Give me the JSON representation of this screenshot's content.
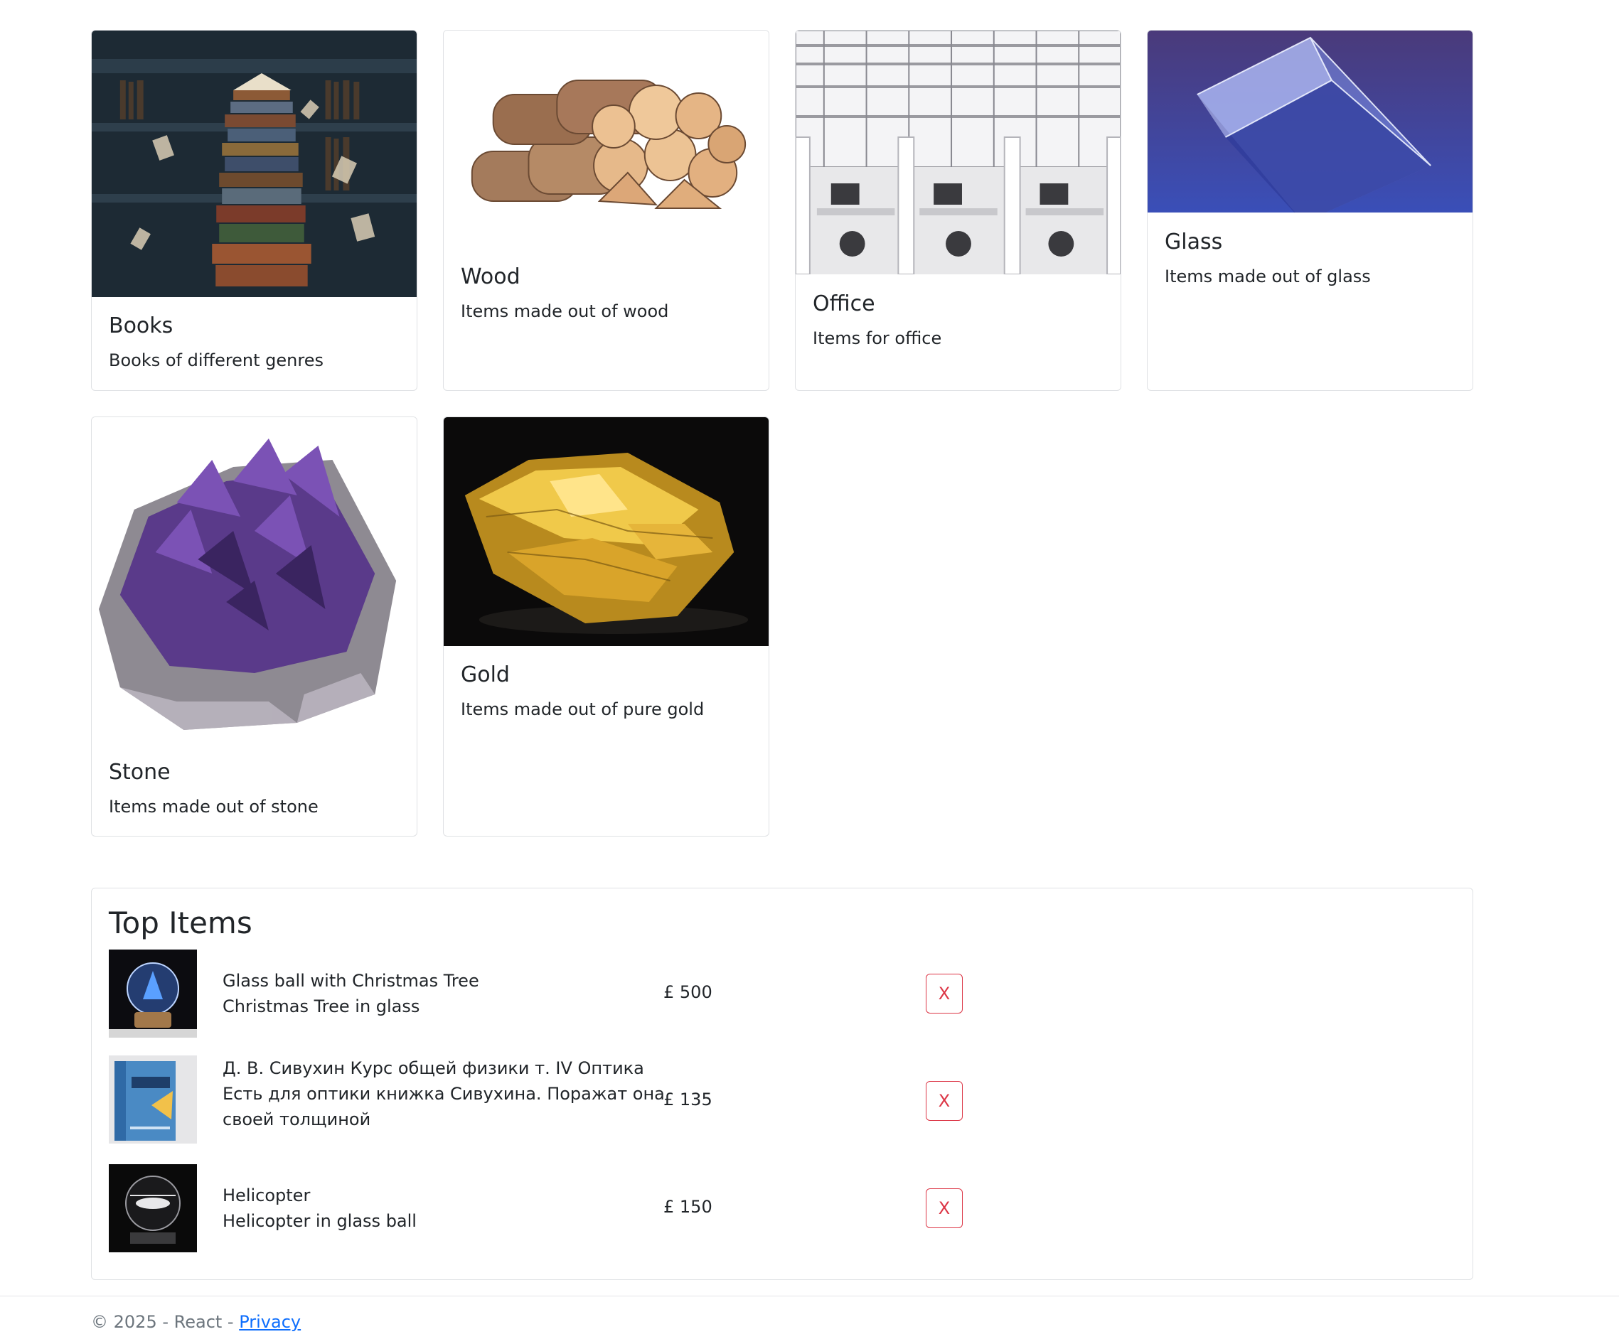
{
  "categories": [
    {
      "title": "Books",
      "description": "Books of different genres",
      "image_icon": "books-image"
    },
    {
      "title": "Wood",
      "description": "Items made out of wood",
      "image_icon": "wood-image"
    },
    {
      "title": "Office",
      "description": "Items for office",
      "image_icon": "office-image"
    },
    {
      "title": "Glass",
      "description": "Items made out of glass",
      "image_icon": "glass-image"
    },
    {
      "title": "Stone",
      "description": "Items made out of stone",
      "image_icon": "stone-image"
    },
    {
      "title": "Gold",
      "description": "Items made out of pure gold",
      "image_icon": "gold-image"
    }
  ],
  "top_items": {
    "title": "Top Items",
    "items": [
      {
        "name": "Glass ball with Christmas Tree",
        "description": "Christmas Tree in glass",
        "price": "£ 500",
        "remove_label": "X"
      },
      {
        "name": "Д. В. Сивухин Курс общей физики т. IV Оптика",
        "description": "Есть для оптики книжка Сивухина. Поражат она своей толщиной",
        "price": "£ 135",
        "remove_label": "X"
      },
      {
        "name": "Helicopter",
        "description": "Helicopter in glass ball",
        "price": "£ 150",
        "remove_label": "X"
      }
    ]
  },
  "footer": {
    "copyright": "© 2025 - React - ",
    "privacy_label": "Privacy"
  },
  "colors": {
    "danger": "#dc3545",
    "link": "#0d6efd",
    "border": "#dfe1e4"
  }
}
